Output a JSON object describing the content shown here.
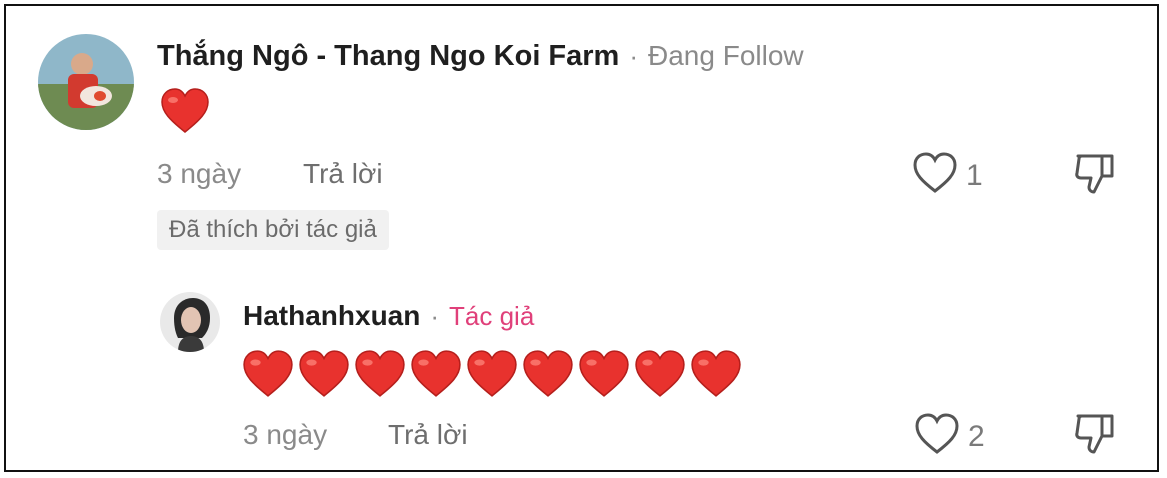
{
  "comment": {
    "author": "Thắng Ngô - Thang Ngo Koi Farm",
    "separator": "·",
    "follow_status": "Đang Follow",
    "content_emoji_count": 1,
    "time": "3 ngày",
    "reply_label": "Trả lời",
    "like_count": "1",
    "liked_by_author": "Đã thích bởi tác giả",
    "icons": {
      "like": "heart-outline-icon",
      "dislike": "thumbs-down-icon",
      "content": "red-heart-emoji"
    }
  },
  "reply": {
    "author": "Hathanhxuan",
    "separator": "·",
    "author_tag": "Tác giả",
    "content_emoji_count": 9,
    "time": "3 ngày",
    "reply_label": "Trả lời",
    "like_count": "2",
    "icons": {
      "like": "heart-outline-icon",
      "dislike": "thumbs-down-icon",
      "content": "red-heart-emoji"
    }
  },
  "colors": {
    "author_tag": "#e0407a",
    "meta_text": "#8a8a8a",
    "heart_emoji": "#e8322e"
  }
}
